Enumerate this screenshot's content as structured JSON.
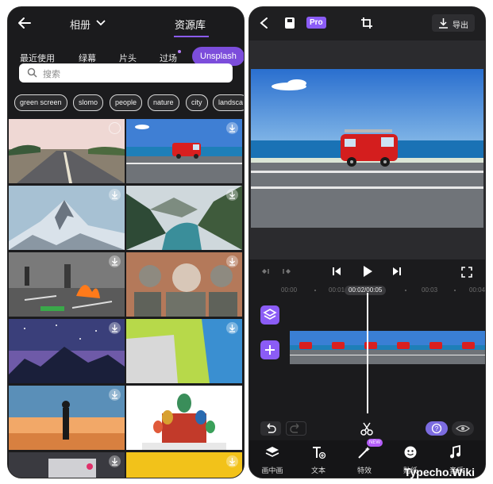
{
  "left_phone": {
    "header": {
      "album_label": "相册",
      "library_tab": "资源库"
    },
    "categories": [
      "最近使用",
      "绿幕",
      "片头",
      "过场"
    ],
    "active_category": "Unsplash",
    "search": {
      "placeholder": "搜索"
    },
    "tags": [
      "green screen",
      "slomo",
      "people",
      "nature",
      "city",
      "landsca"
    ]
  },
  "right_phone": {
    "header": {
      "pro_badge": "Pro",
      "export_label": "导出"
    },
    "timeline": {
      "ticks": [
        "00:00",
        "00:01",
        "00:03",
        "00:04"
      ],
      "current_time": "00:02/00:05"
    },
    "tabbar": [
      {
        "label": "画中画",
        "icon": "layers-add-icon"
      },
      {
        "label": "文本",
        "icon": "text-add-icon"
      },
      {
        "label": "特效",
        "icon": "magic-wand-icon",
        "badge": "NEW"
      },
      {
        "label": "贴纸",
        "icon": "sticker-icon"
      },
      {
        "label": "音乐",
        "icon": "music-add-icon"
      }
    ]
  },
  "watermark": "Typecho.Wiki",
  "colors": {
    "accent": "#8b5cf6",
    "background": "#1b1b1d"
  }
}
